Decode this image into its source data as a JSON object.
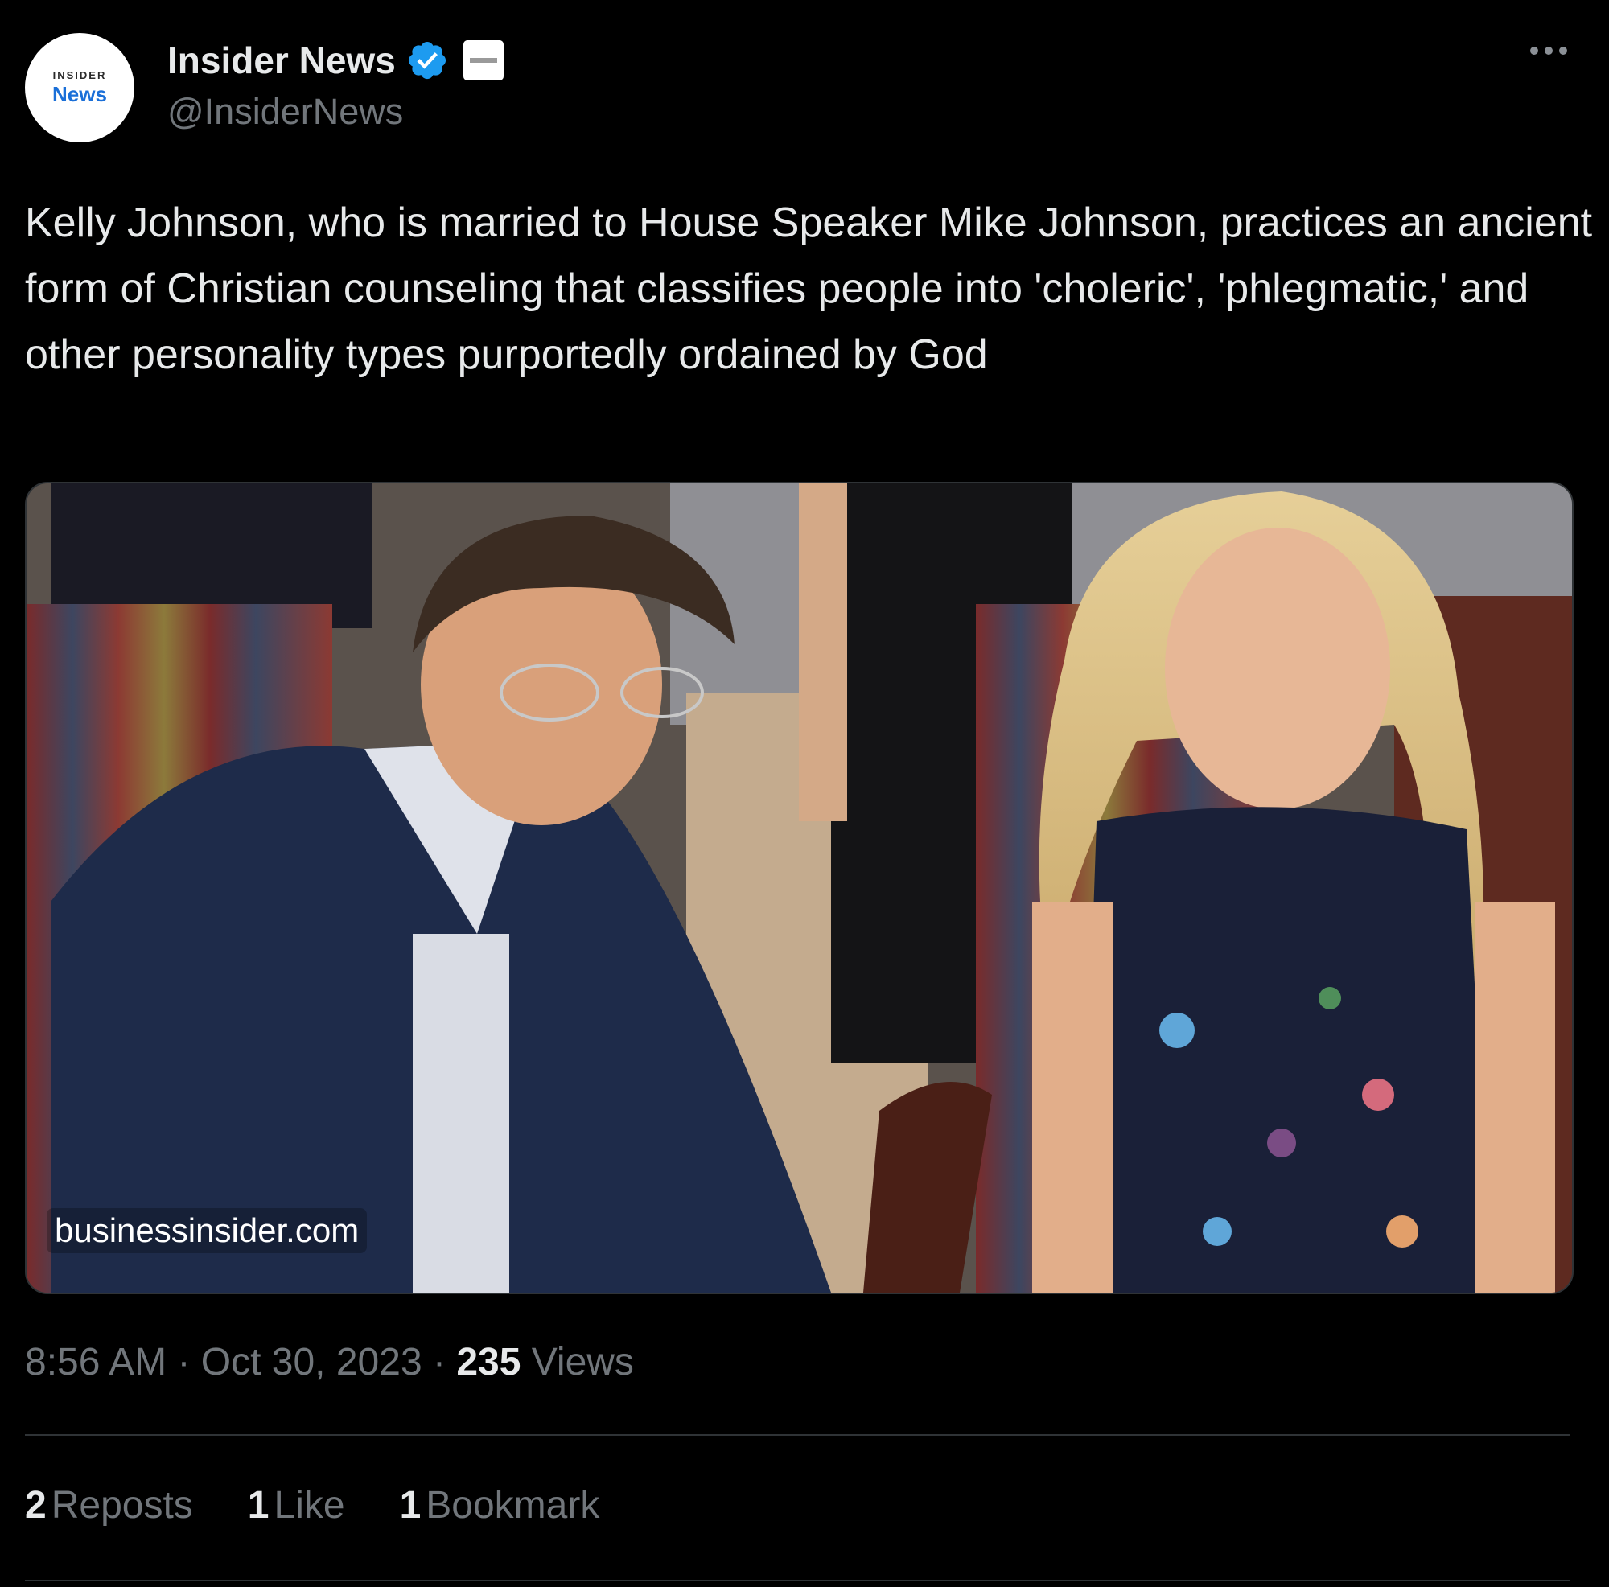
{
  "account": {
    "avatar_top": "INSIDER",
    "avatar_bottom": "News",
    "display_name": "Insider News",
    "handle": "@InsiderNews"
  },
  "icons": {
    "verified": "verified-checkmark-icon",
    "affiliate": "affiliate-badge-icon",
    "more": "more-options-icon"
  },
  "colors": {
    "background": "#000000",
    "text_primary": "#e7e9ea",
    "text_secondary": "#71767b",
    "verified_blue": "#1d9bf0",
    "divider": "#2f3336"
  },
  "tweet": {
    "text": "Kelly Johnson, who is married to House Speaker Mike Johnson, practices an ancient form of Christian counseling that classifies people into 'choleric', 'phlegmatic,' and other personality types purportedly ordained by God"
  },
  "media": {
    "domain": "businessinsider.com"
  },
  "meta": {
    "time": "8:56 AM",
    "separator": "·",
    "date": "Oct 30, 2023",
    "views_count": "235",
    "views_label": "Views"
  },
  "engagement": {
    "reposts_count": "2",
    "reposts_label": "Reposts",
    "likes_count": "1",
    "likes_label": "Like",
    "bookmarks_count": "1",
    "bookmarks_label": "Bookmark"
  }
}
